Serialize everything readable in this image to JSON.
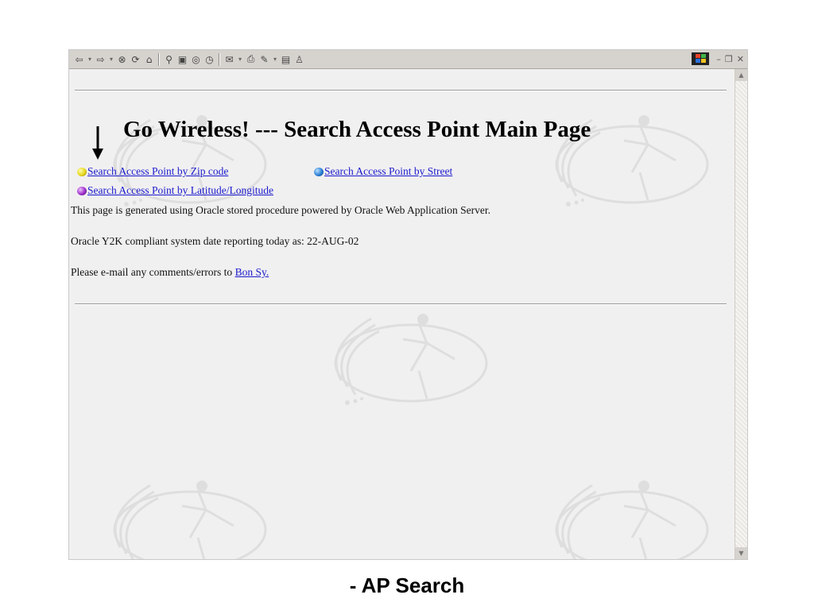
{
  "toolbar": {
    "icons": [
      "back-icon",
      "forward-icon",
      "stop-icon",
      "refresh-icon",
      "home-icon",
      "search-icon",
      "favorites-icon",
      "media-icon",
      "history-icon",
      "mail-icon",
      "print-icon",
      "edit-icon",
      "discuss-icon",
      "messenger-icon"
    ]
  },
  "page": {
    "title": "Go Wireless! --- Search Access Point Main Page",
    "links": [
      {
        "label": "Search Access Point by Zip code",
        "bullet_color": "#e6d81c"
      },
      {
        "label": "Search Access Point by Street",
        "bullet_color": "#2a7fd4"
      },
      {
        "label": "Search Access Point by Latitude/Longitude",
        "bullet_color": "#9b2fc9"
      }
    ],
    "generated_text": "This page is generated using Oracle stored procedure powered by Oracle Web Application Server.",
    "y2k_text": "Oracle Y2K compliant system date reporting today as: 22-AUG-02",
    "email_text": "Please e-mail any comments/errors to",
    "email_link": "Bon Sy."
  },
  "caption": "- AP Search"
}
